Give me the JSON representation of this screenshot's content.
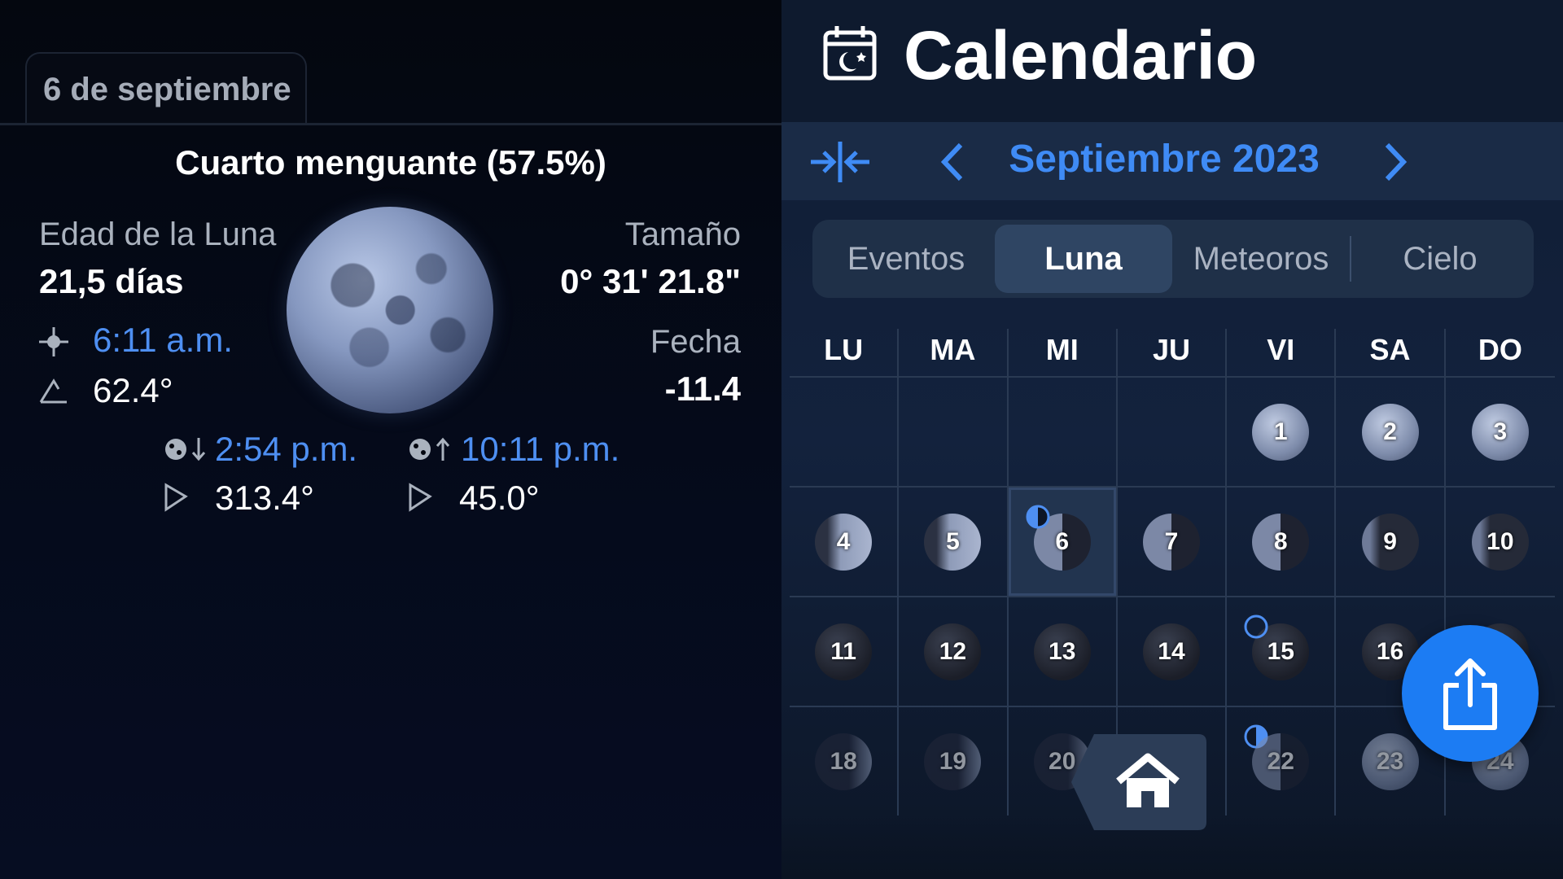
{
  "left": {
    "date_tab": "6 de septiembre",
    "phase_title": "Cuarto menguante (57.5%)",
    "moon_age_label": "Edad de la Luna",
    "moon_age_value": "21,5 días",
    "size_label": "Tamaño",
    "size_value": "0° 31' 21.8\"",
    "transit_time": "6:11 a.m.",
    "altitude": "62.4°",
    "date_label": "Fecha",
    "date_value": "-11.4",
    "set_time": "2:54 p.m.",
    "set_azimuth": "313.4°",
    "rise_time": "10:11 p.m.",
    "rise_azimuth": "45.0°"
  },
  "right": {
    "title": "Calendario",
    "month": "Septiembre 2023",
    "tabs": [
      "Eventos",
      "Luna",
      "Meteoros",
      "Cielo"
    ],
    "active_tab": "Luna",
    "weekdays": [
      "LU",
      "MA",
      "MI",
      "JU",
      "VI",
      "SA",
      "DO"
    ],
    "weeks": [
      [
        "",
        "",
        "",
        "",
        "1",
        "2",
        "3"
      ],
      [
        "4",
        "5",
        "6",
        "7",
        "8",
        "9",
        "10"
      ],
      [
        "11",
        "12",
        "13",
        "14",
        "15",
        "16",
        ""
      ],
      [
        "18",
        "19",
        "20",
        "",
        "22",
        "23",
        "24"
      ]
    ],
    "today": "6"
  },
  "colors": {
    "accent": "#3f8bf5",
    "share_button": "#1c7cf3",
    "left_bg": "#03060f",
    "right_bg": "#13223d"
  },
  "icons": {
    "calendar": "calendar-moon-icon",
    "collapse": "collapse-arrows-icon",
    "prev": "chevron-left-icon",
    "next": "chevron-right-icon",
    "home": "home-icon",
    "share": "share-icon"
  }
}
